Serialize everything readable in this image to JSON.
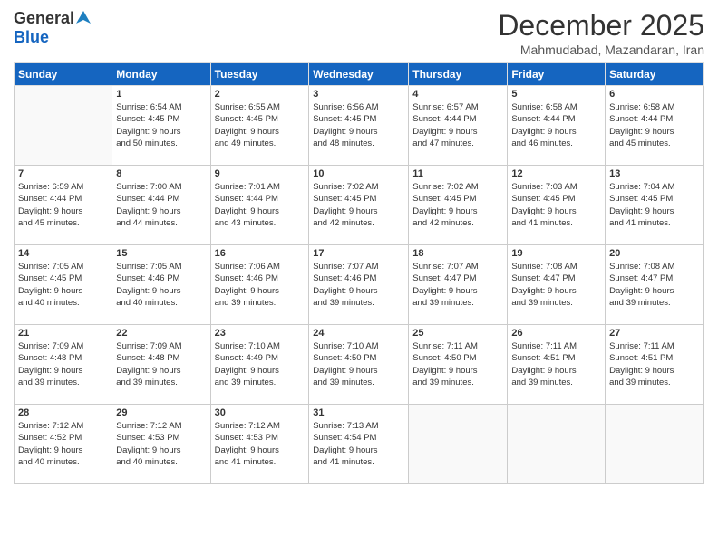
{
  "header": {
    "logo_general": "General",
    "logo_blue": "Blue",
    "title": "December 2025",
    "subtitle": "Mahmudabad, Mazandaran, Iran"
  },
  "weekdays": [
    "Sunday",
    "Monday",
    "Tuesday",
    "Wednesday",
    "Thursday",
    "Friday",
    "Saturday"
  ],
  "weeks": [
    [
      {
        "day": "",
        "content": ""
      },
      {
        "day": "1",
        "content": "Sunrise: 6:54 AM\nSunset: 4:45 PM\nDaylight: 9 hours\nand 50 minutes."
      },
      {
        "day": "2",
        "content": "Sunrise: 6:55 AM\nSunset: 4:45 PM\nDaylight: 9 hours\nand 49 minutes."
      },
      {
        "day": "3",
        "content": "Sunrise: 6:56 AM\nSunset: 4:45 PM\nDaylight: 9 hours\nand 48 minutes."
      },
      {
        "day": "4",
        "content": "Sunrise: 6:57 AM\nSunset: 4:44 PM\nDaylight: 9 hours\nand 47 minutes."
      },
      {
        "day": "5",
        "content": "Sunrise: 6:58 AM\nSunset: 4:44 PM\nDaylight: 9 hours\nand 46 minutes."
      },
      {
        "day": "6",
        "content": "Sunrise: 6:58 AM\nSunset: 4:44 PM\nDaylight: 9 hours\nand 45 minutes."
      }
    ],
    [
      {
        "day": "7",
        "content": "Sunrise: 6:59 AM\nSunset: 4:44 PM\nDaylight: 9 hours\nand 45 minutes."
      },
      {
        "day": "8",
        "content": "Sunrise: 7:00 AM\nSunset: 4:44 PM\nDaylight: 9 hours\nand 44 minutes."
      },
      {
        "day": "9",
        "content": "Sunrise: 7:01 AM\nSunset: 4:44 PM\nDaylight: 9 hours\nand 43 minutes."
      },
      {
        "day": "10",
        "content": "Sunrise: 7:02 AM\nSunset: 4:45 PM\nDaylight: 9 hours\nand 42 minutes."
      },
      {
        "day": "11",
        "content": "Sunrise: 7:02 AM\nSunset: 4:45 PM\nDaylight: 9 hours\nand 42 minutes."
      },
      {
        "day": "12",
        "content": "Sunrise: 7:03 AM\nSunset: 4:45 PM\nDaylight: 9 hours\nand 41 minutes."
      },
      {
        "day": "13",
        "content": "Sunrise: 7:04 AM\nSunset: 4:45 PM\nDaylight: 9 hours\nand 41 minutes."
      }
    ],
    [
      {
        "day": "14",
        "content": "Sunrise: 7:05 AM\nSunset: 4:45 PM\nDaylight: 9 hours\nand 40 minutes."
      },
      {
        "day": "15",
        "content": "Sunrise: 7:05 AM\nSunset: 4:46 PM\nDaylight: 9 hours\nand 40 minutes."
      },
      {
        "day": "16",
        "content": "Sunrise: 7:06 AM\nSunset: 4:46 PM\nDaylight: 9 hours\nand 39 minutes."
      },
      {
        "day": "17",
        "content": "Sunrise: 7:07 AM\nSunset: 4:46 PM\nDaylight: 9 hours\nand 39 minutes."
      },
      {
        "day": "18",
        "content": "Sunrise: 7:07 AM\nSunset: 4:47 PM\nDaylight: 9 hours\nand 39 minutes."
      },
      {
        "day": "19",
        "content": "Sunrise: 7:08 AM\nSunset: 4:47 PM\nDaylight: 9 hours\nand 39 minutes."
      },
      {
        "day": "20",
        "content": "Sunrise: 7:08 AM\nSunset: 4:47 PM\nDaylight: 9 hours\nand 39 minutes."
      }
    ],
    [
      {
        "day": "21",
        "content": "Sunrise: 7:09 AM\nSunset: 4:48 PM\nDaylight: 9 hours\nand 39 minutes."
      },
      {
        "day": "22",
        "content": "Sunrise: 7:09 AM\nSunset: 4:48 PM\nDaylight: 9 hours\nand 39 minutes."
      },
      {
        "day": "23",
        "content": "Sunrise: 7:10 AM\nSunset: 4:49 PM\nDaylight: 9 hours\nand 39 minutes."
      },
      {
        "day": "24",
        "content": "Sunrise: 7:10 AM\nSunset: 4:50 PM\nDaylight: 9 hours\nand 39 minutes."
      },
      {
        "day": "25",
        "content": "Sunrise: 7:11 AM\nSunset: 4:50 PM\nDaylight: 9 hours\nand 39 minutes."
      },
      {
        "day": "26",
        "content": "Sunrise: 7:11 AM\nSunset: 4:51 PM\nDaylight: 9 hours\nand 39 minutes."
      },
      {
        "day": "27",
        "content": "Sunrise: 7:11 AM\nSunset: 4:51 PM\nDaylight: 9 hours\nand 39 minutes."
      }
    ],
    [
      {
        "day": "28",
        "content": "Sunrise: 7:12 AM\nSunset: 4:52 PM\nDaylight: 9 hours\nand 40 minutes."
      },
      {
        "day": "29",
        "content": "Sunrise: 7:12 AM\nSunset: 4:53 PM\nDaylight: 9 hours\nand 40 minutes."
      },
      {
        "day": "30",
        "content": "Sunrise: 7:12 AM\nSunset: 4:53 PM\nDaylight: 9 hours\nand 41 minutes."
      },
      {
        "day": "31",
        "content": "Sunrise: 7:13 AM\nSunset: 4:54 PM\nDaylight: 9 hours\nand 41 minutes."
      },
      {
        "day": "",
        "content": ""
      },
      {
        "day": "",
        "content": ""
      },
      {
        "day": "",
        "content": ""
      }
    ]
  ]
}
